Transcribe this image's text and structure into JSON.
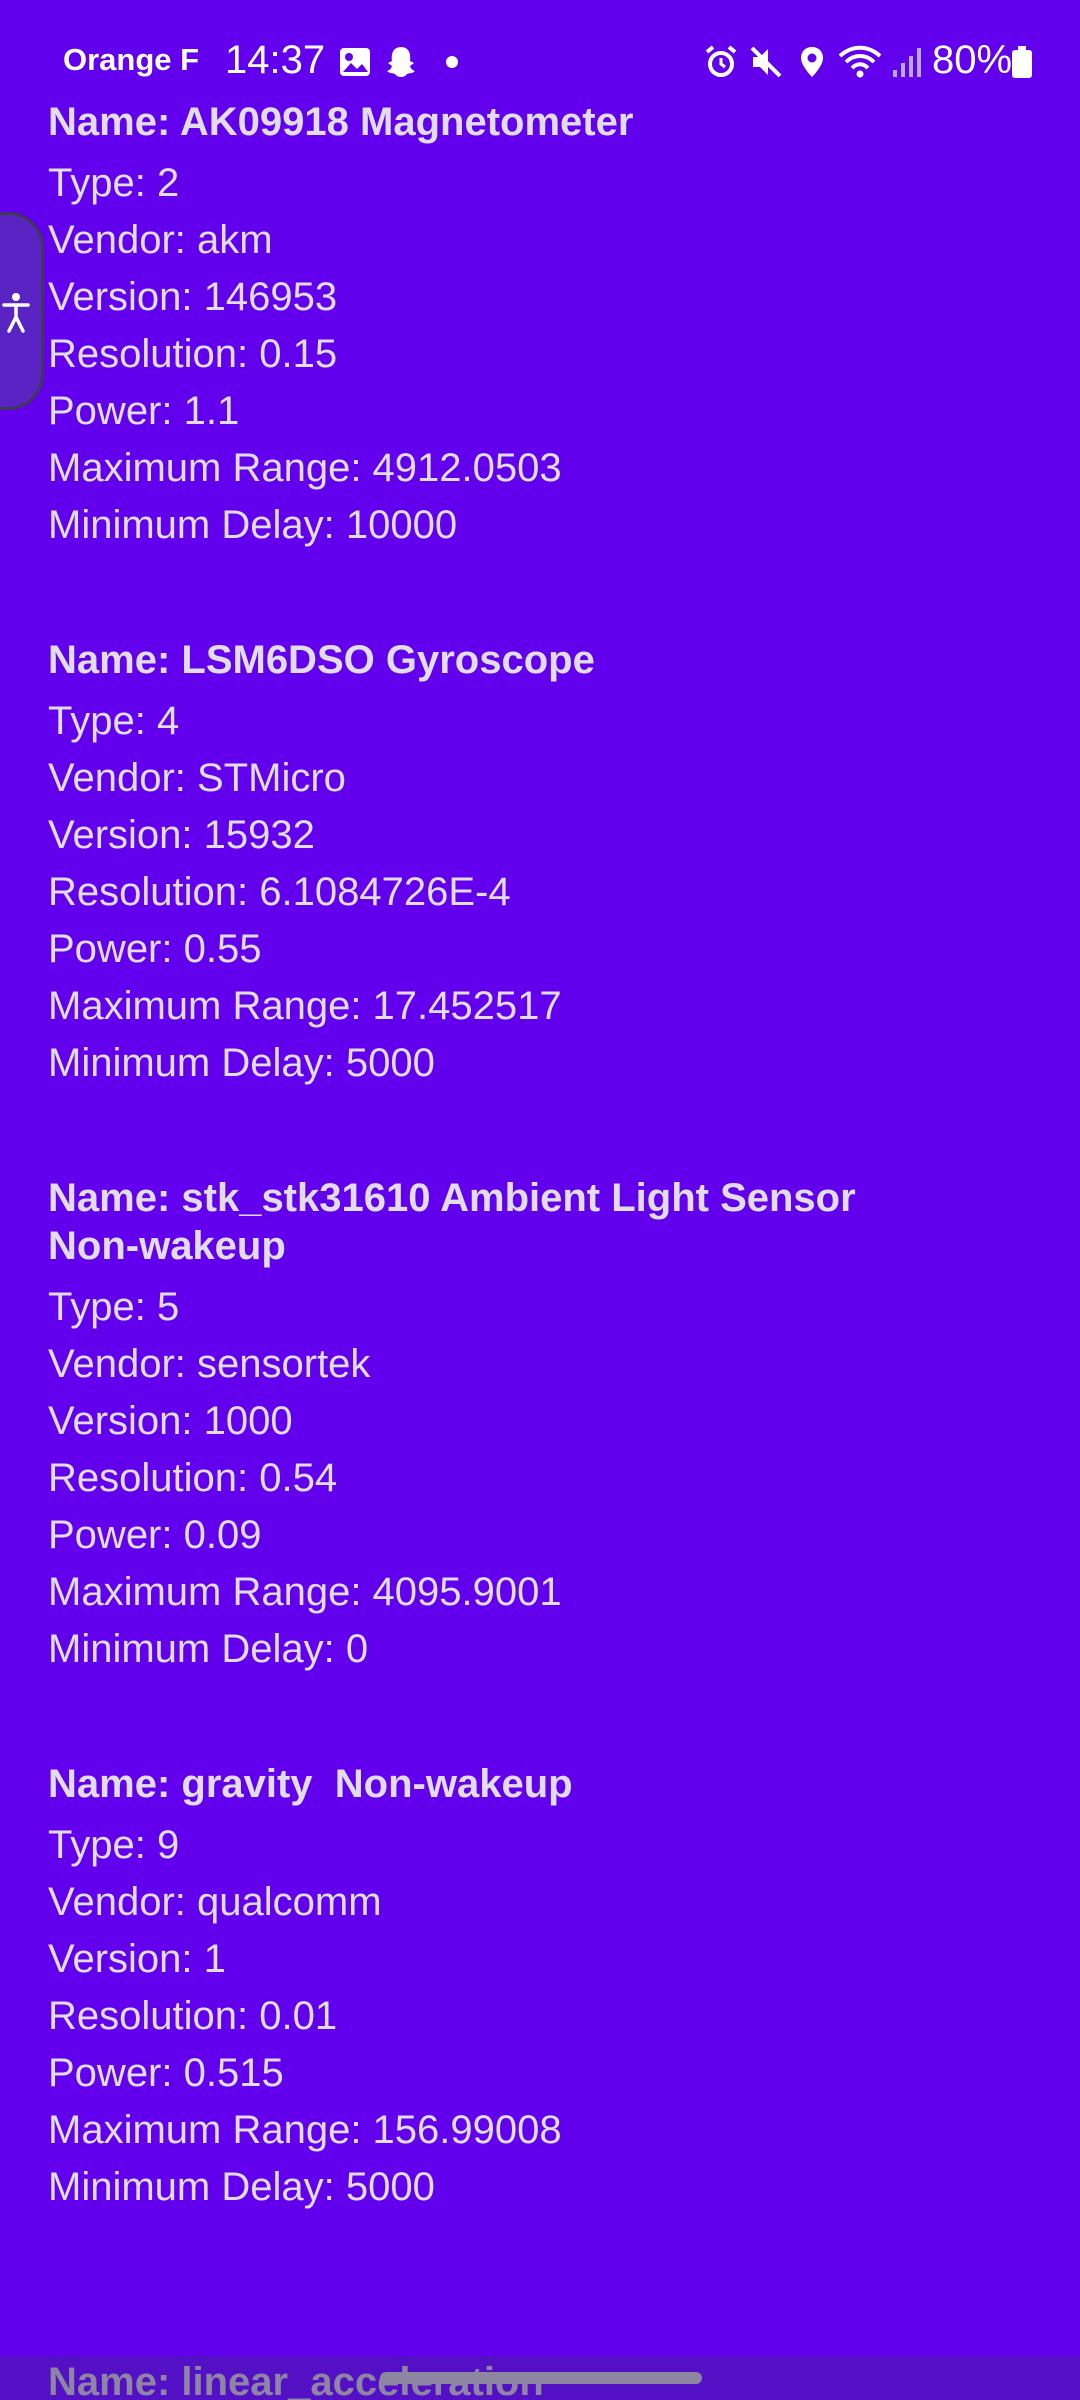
{
  "status_bar": {
    "carrier": "Orange F",
    "time": "14:37",
    "battery": "80%",
    "icons": [
      "image-icon",
      "snapchat-icon",
      "dot-icon",
      "alarm-icon",
      "mute-icon",
      "location-icon",
      "wifi-icon",
      "signal-icon",
      "battery-icon"
    ]
  },
  "sensors": [
    {
      "name": "Name: AK09918 Magnetometer",
      "type": "Type: 2",
      "vendor": "Vendor: akm",
      "version": "Version: 146953",
      "resolution": "Resolution: 0.15",
      "power": "Power: 1.1",
      "max_range": "Maximum Range: 4912.0503",
      "min_delay": "Minimum Delay: 10000"
    },
    {
      "name": "Name: LSM6DSO Gyroscope",
      "type": "Type: 4",
      "vendor": "Vendor: STMicro",
      "version": "Version: 15932",
      "resolution": "Resolution: 6.1084726E-4",
      "power": "Power: 0.55",
      "max_range": "Maximum Range: 17.452517",
      "min_delay": "Minimum Delay: 5000"
    },
    {
      "name": "Name: stk_stk31610 Ambient Light Sensor Non-wakeup",
      "type": "Type: 5",
      "vendor": "Vendor: sensortek",
      "version": "Version: 1000",
      "resolution": "Resolution: 0.54",
      "power": "Power: 0.09",
      "max_range": "Maximum Range: 4095.9001",
      "min_delay": "Minimum Delay: 0"
    },
    {
      "name": "Name: gravity  Non-wakeup",
      "type": "Type: 9",
      "vendor": "Vendor: qualcomm",
      "version": "Version: 1",
      "resolution": "Resolution: 0.01",
      "power": "Power: 0.515",
      "max_range": "Maximum Range: 156.99008",
      "min_delay": "Minimum Delay: 5000"
    }
  ],
  "partial_sensor_name": "Name: linear_acceleration",
  "colors": {
    "background": "#6200EE",
    "text": "#E2DCEF",
    "status_text": "#FFFFFF"
  }
}
